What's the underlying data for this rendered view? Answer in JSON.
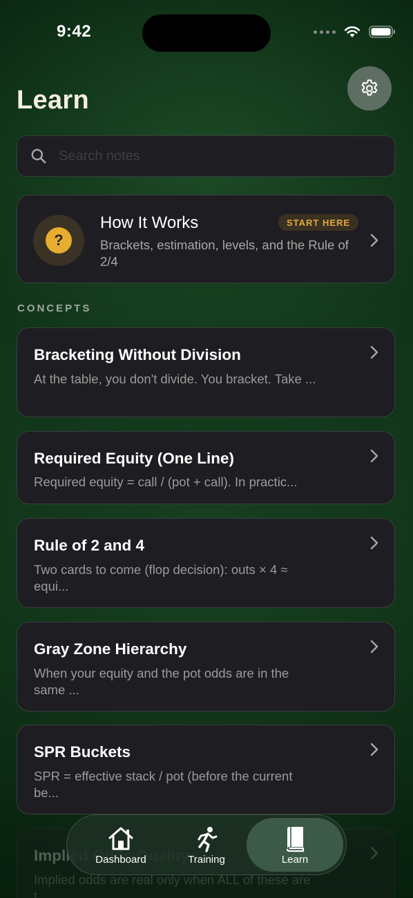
{
  "status": {
    "time": "9:42"
  },
  "header": {
    "title": "Learn"
  },
  "search": {
    "placeholder": "Search notes"
  },
  "how_it_works": {
    "title": "How It Works",
    "badge": "START HERE",
    "subtitle": "Brackets, estimation, levels, and the Rule of 2/4",
    "icon_glyph": "?"
  },
  "section": {
    "label": "CONCEPTS"
  },
  "concepts": [
    {
      "title": "Bracketing Without Division",
      "desc": "At the table, you don't divide. You bracket. Take ..."
    },
    {
      "title": "Required Equity (One Line)",
      "desc": "Required equity = call / (pot + call).  In practic..."
    },
    {
      "title": "Rule of 2 and 4",
      "desc": "Two cards to come (flop decision): outs × 4 ≈ equi..."
    },
    {
      "title": "Gray Zone Hierarchy",
      "desc": "When your equity and the pot odds are in the same ..."
    },
    {
      "title": "SPR Buckets",
      "desc": "SPR = effective stack / pot (before the current be..."
    },
    {
      "title": "Implied Odds Quality",
      "desc": "Implied odds are real only when ALL of these are t..."
    }
  ],
  "tabs": [
    {
      "label": "Dashboard",
      "icon": "house-icon"
    },
    {
      "label": "Training",
      "icon": "running-figure-icon"
    },
    {
      "label": "Learn",
      "icon": "book-icon",
      "active": true
    }
  ],
  "colors": {
    "accent_gold": "#e6ad2f",
    "card_bg": "#1e1d22",
    "active_tab": "#3c5a47"
  }
}
